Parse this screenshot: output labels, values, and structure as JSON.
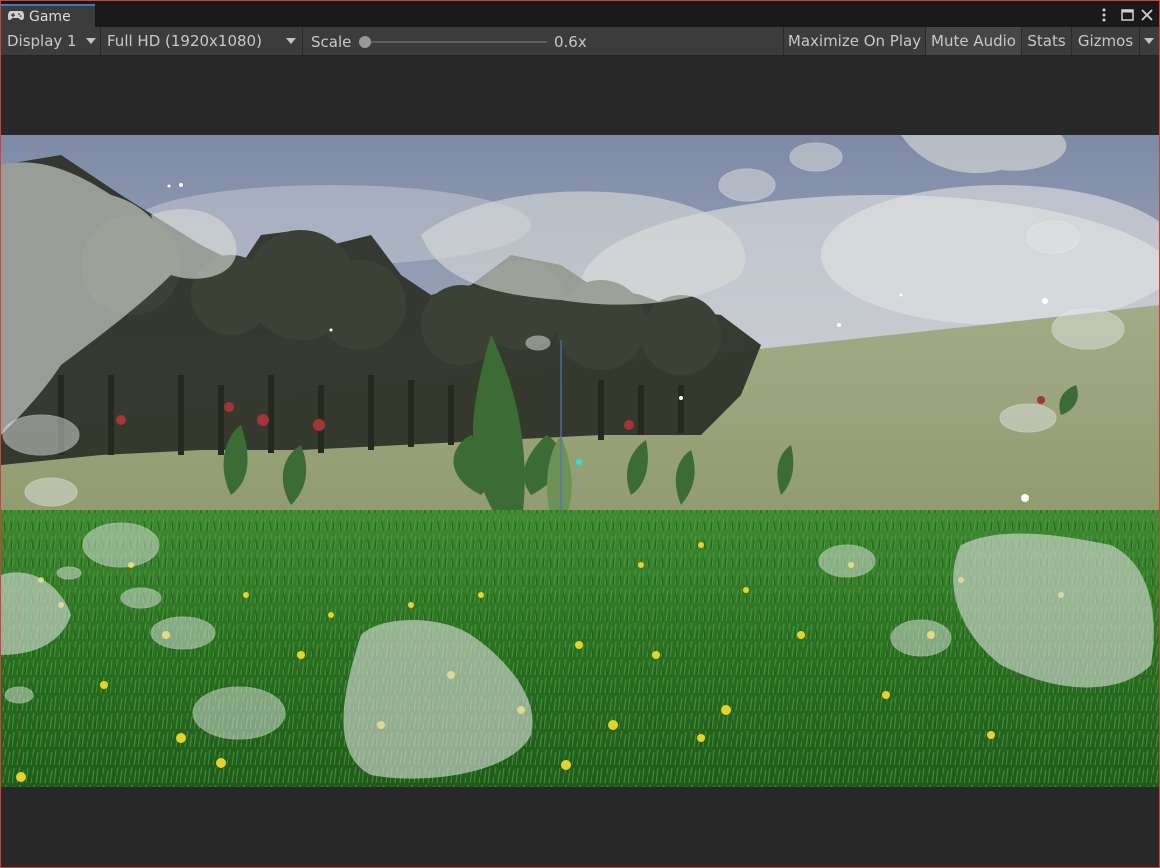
{
  "tab": {
    "title": "Game",
    "icon": "gamepad-icon"
  },
  "window_controls": {
    "menu": "kebab-menu-icon",
    "maximize": "maximize-icon",
    "close": "close-icon"
  },
  "toolbar": {
    "display": "Display 1",
    "resolution": "Full HD (1920x1080)",
    "scale_label": "Scale",
    "scale_value": "0.6x",
    "maximize_on_play": "Maximize On Play",
    "mute_audio": "Mute Audio",
    "stats": "Stats",
    "gizmos": "Gizmos"
  },
  "colors": {
    "border": "#d04040",
    "tab_accent": "#3a79bb",
    "toolbar": "#3c3c3c",
    "background": "#282828"
  }
}
